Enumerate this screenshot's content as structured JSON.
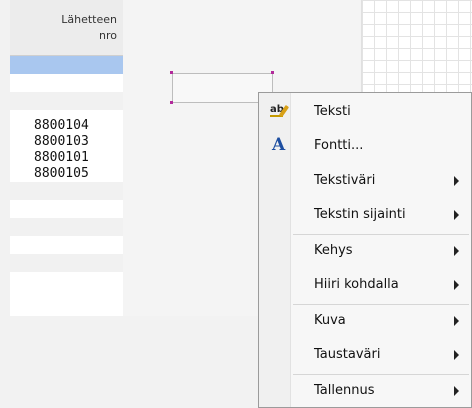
{
  "column_header": {
    "line1": "Lähetteen",
    "line2": "nro"
  },
  "rows": [
    "8800104",
    "8800103",
    "8800101",
    "8800105"
  ],
  "context_menu": {
    "items": [
      {
        "label": "Teksti",
        "icon": "text-edit-icon",
        "submenu": false
      },
      {
        "label": "Fontti...",
        "icon": "font-icon",
        "submenu": false
      },
      {
        "label": "Tekstiväri",
        "submenu": true
      },
      {
        "label": "Tekstin sijainti",
        "submenu": true
      },
      {
        "label": "Kehys",
        "submenu": true
      },
      {
        "label": "Hiiri kohdalla",
        "submenu": true
      },
      {
        "label": "Kuva",
        "submenu": true
      },
      {
        "label": "Taustaväri",
        "submenu": true
      },
      {
        "label": "Tallennus",
        "submenu": true
      }
    ]
  },
  "colors": {
    "selection": "#a9c7ef",
    "font_icon": "#1e4fa1",
    "handle": "#b22a9b"
  }
}
